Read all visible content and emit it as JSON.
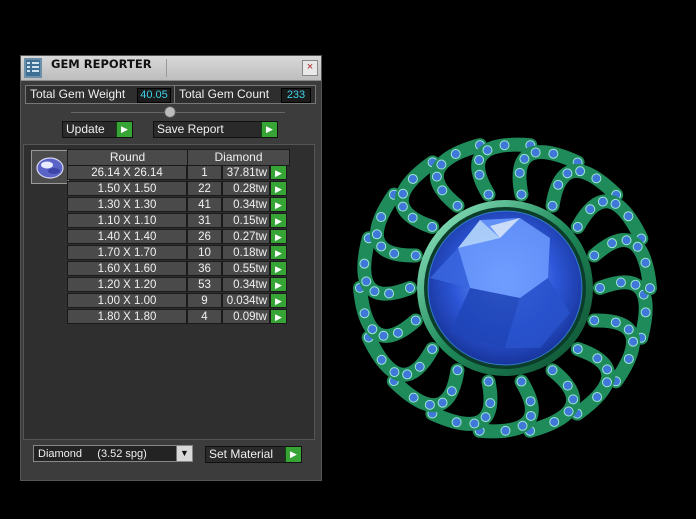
{
  "window": {
    "title": "GEM REPORTER",
    "close_glyph": "×"
  },
  "stats": {
    "weight_label": "Total Gem Weight",
    "weight_value": "40.05",
    "count_label": "Total Gem Count",
    "count_value": "233"
  },
  "buttons": {
    "update": "Update",
    "save_report": "Save Report",
    "set_material": "Set Material",
    "go_glyph": "▶"
  },
  "table": {
    "headers": {
      "shape": "Round",
      "material": "Diamond"
    },
    "rows": [
      {
        "size": "26.14 X 26.14",
        "count": "1",
        "weight": "37.81tw"
      },
      {
        "size": "1.50 X 1.50",
        "count": "22",
        "weight": "0.28tw"
      },
      {
        "size": "1.30 X 1.30",
        "count": "41",
        "weight": "0.34tw"
      },
      {
        "size": "1.10 X 1.10",
        "count": "31",
        "weight": "0.15tw"
      },
      {
        "size": "1.40 X 1.40",
        "count": "26",
        "weight": "0.27tw"
      },
      {
        "size": "1.70 X 1.70",
        "count": "10",
        "weight": "0.18tw"
      },
      {
        "size": "1.60 X 1.60",
        "count": "36",
        "weight": "0.55tw"
      },
      {
        "size": "1.20 X 1.20",
        "count": "53",
        "weight": "0.34tw"
      },
      {
        "size": "1.00 X 1.00",
        "count": "9",
        "weight": "0.034tw"
      },
      {
        "size": "1.80 X 1.80",
        "count": "4",
        "weight": "0.09tw"
      }
    ]
  },
  "material_select": {
    "value": "Diamond     (3.52 spg)",
    "arrow_glyph": "▼"
  },
  "colors": {
    "accent_green": "#36a536",
    "value_cyan": "#3fd1e8",
    "gem_blue": "#2b5fd6",
    "metal_green": "#1f8a5a"
  },
  "icons": {
    "title_icon": "gem-reporter-icon",
    "thumb": "round-gem-thumbnail-icon",
    "go": "green-play-arrow-icon",
    "render": "sapphire-brooch-render"
  }
}
